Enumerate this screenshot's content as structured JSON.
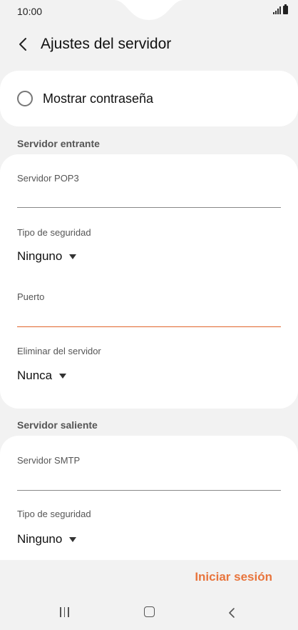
{
  "status_bar": {
    "time": "10:00"
  },
  "header": {
    "title": "Ajustes del servidor"
  },
  "show_password": {
    "label": "Mostrar contraseña"
  },
  "incoming": {
    "section_title": "Servidor entrante",
    "server_label": "Servidor POP3",
    "server_value": "",
    "security_label": "Tipo de seguridad",
    "security_value": "Ninguno",
    "port_label": "Puerto",
    "port_value": "",
    "delete_label": "Eliminar del servidor",
    "delete_value": "Nunca"
  },
  "outgoing": {
    "section_title": "Servidor saliente",
    "server_label": "Servidor SMTP",
    "server_value": "",
    "security_label": "Tipo de seguridad",
    "security_value": "Ninguno"
  },
  "footer": {
    "sign_in_label": "Iniciar sesión"
  },
  "colors": {
    "accent": "#e8753d",
    "active_underline": "#e0652c",
    "background": "#f2f2f2",
    "card": "#ffffff"
  }
}
